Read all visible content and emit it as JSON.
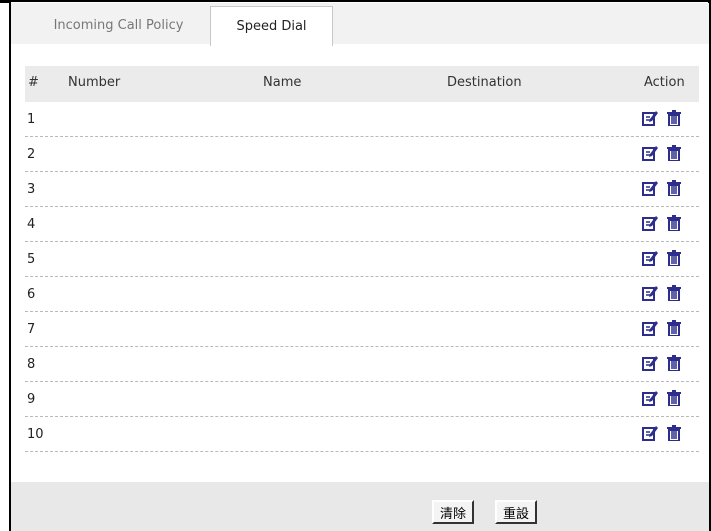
{
  "tabs": [
    {
      "label": "Incoming Call Policy",
      "active": false
    },
    {
      "label": "Speed Dial",
      "active": true
    }
  ],
  "table": {
    "headers": {
      "num": "#",
      "number": "Number",
      "name": "Name",
      "destination": "Destination",
      "action": "Action"
    },
    "rows": [
      {
        "num": "1"
      },
      {
        "num": "2"
      },
      {
        "num": "3"
      },
      {
        "num": "4"
      },
      {
        "num": "5"
      },
      {
        "num": "6"
      },
      {
        "num": "7"
      },
      {
        "num": "8"
      },
      {
        "num": "9"
      },
      {
        "num": "10"
      }
    ]
  },
  "footer": {
    "apply_label": "清除",
    "reset_label": "重設"
  },
  "icons": {
    "edit": "edit-icon",
    "delete": "trash-icon",
    "icon_color": "#2d2d8c"
  }
}
